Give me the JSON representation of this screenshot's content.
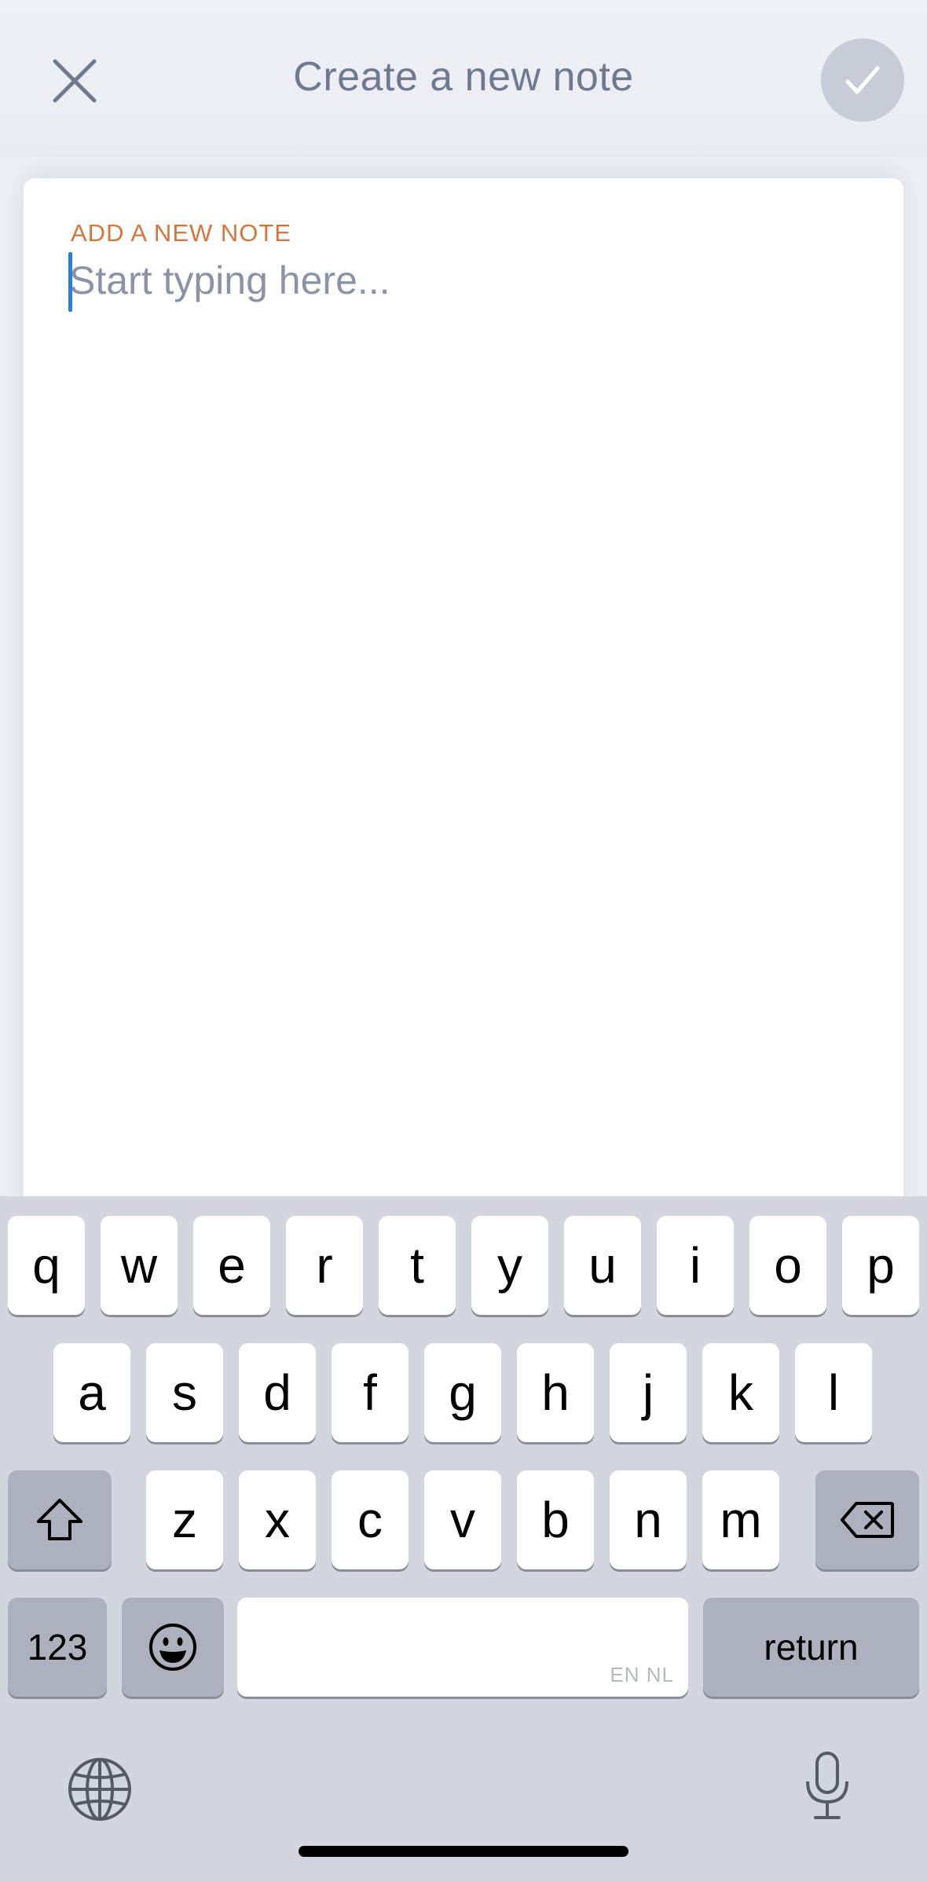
{
  "header": {
    "title": "Create a new note",
    "close_icon": "close-icon",
    "confirm_icon": "checkmark-icon",
    "confirm_bg": "#c7ccd7"
  },
  "note": {
    "label": "ADD A NEW NOTE",
    "label_color": "#d6763c",
    "input_value": "",
    "placeholder": "Start typing here..."
  },
  "keyboard": {
    "row1": [
      "q",
      "w",
      "e",
      "r",
      "t",
      "y",
      "u",
      "i",
      "o",
      "p"
    ],
    "row2": [
      "a",
      "s",
      "d",
      "f",
      "g",
      "h",
      "j",
      "k",
      "l"
    ],
    "row3": [
      "z",
      "x",
      "c",
      "v",
      "b",
      "n",
      "m"
    ],
    "numbers_label": "123",
    "space_language": "EN NL",
    "return_label": "return",
    "icons": {
      "shift": "shift-icon",
      "delete": "backspace-icon",
      "emoji": "emoji-icon",
      "globe": "globe-icon",
      "mic": "microphone-icon"
    }
  }
}
